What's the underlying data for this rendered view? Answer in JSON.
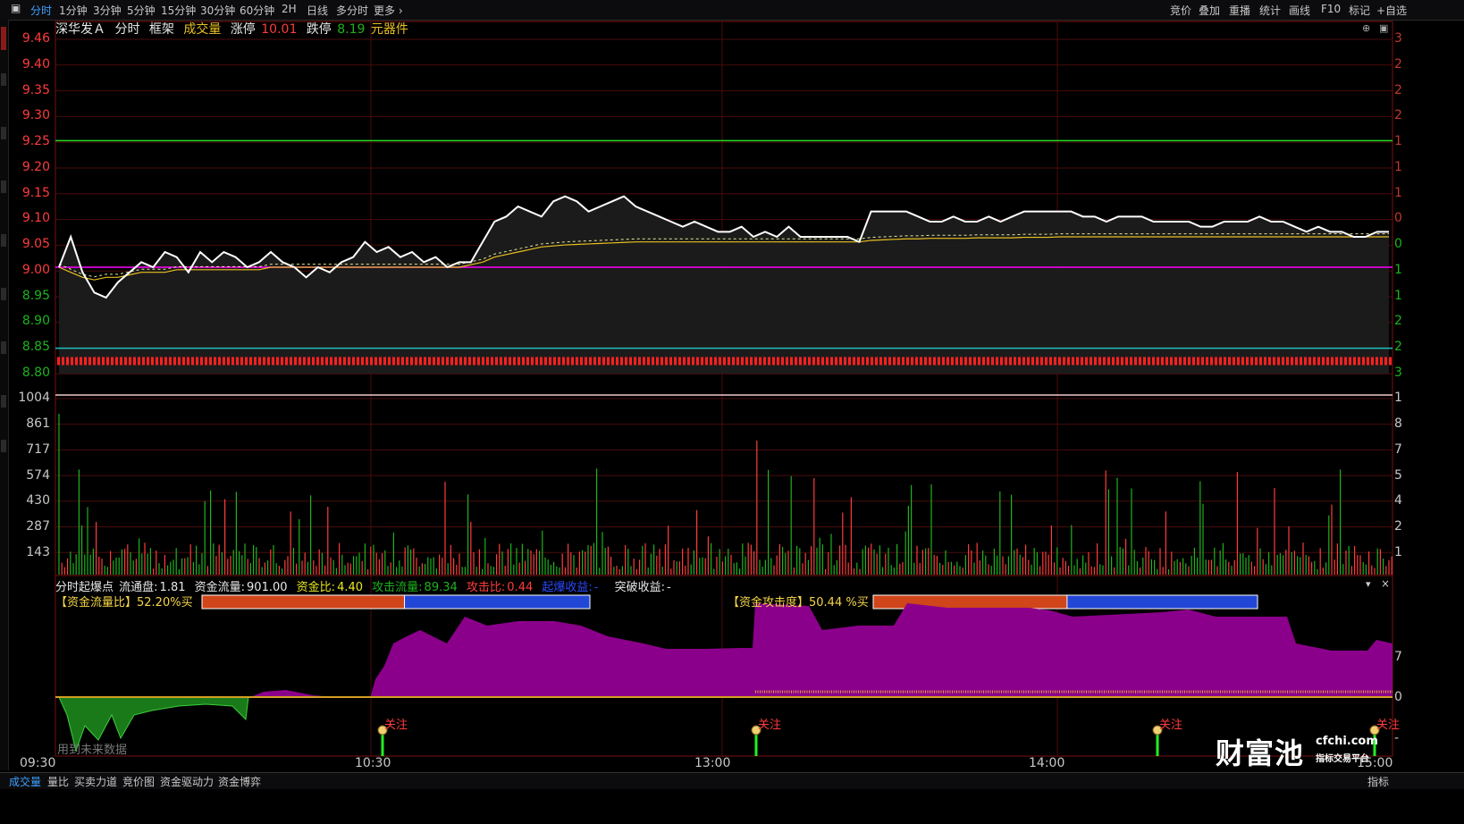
{
  "toolbar": {
    "periods": [
      "分时",
      "1分钟",
      "3分钟",
      "5分钟",
      "15分钟",
      "30分钟",
      "60分钟",
      "2H",
      "日线",
      "多分时",
      "更多 ›"
    ],
    "active_period": "分时",
    "right_tools": [
      "竞价",
      "叠加",
      "重播",
      "统计",
      "画线",
      "F10",
      "标记",
      "+自选"
    ]
  },
  "stock": {
    "name": "深华发Ａ",
    "view": "分时",
    "frame": "框架",
    "volume_label": "成交量",
    "limit_up_label": "涨停",
    "limit_up": "10.01",
    "limit_down_label": "跌停",
    "limit_down": "8.19",
    "sector": "元器件"
  },
  "price_axis": [
    "9.46",
    "9.40",
    "9.35",
    "9.30",
    "9.25",
    "9.20",
    "9.15",
    "9.10",
    "9.05",
    "9.00",
    "8.95",
    "8.90",
    "8.85",
    "8.80"
  ],
  "volume_axis": [
    "1004",
    "861",
    "717",
    "574",
    "430",
    "287",
    "143"
  ],
  "right_axis": [
    "3",
    "2",
    "2",
    "2",
    "1",
    "1",
    "1",
    "0",
    "0",
    "1",
    "1",
    "2",
    "2",
    "3",
    "1",
    "8",
    "7",
    "5",
    "4",
    "2",
    "1",
    "7",
    "0",
    "-"
  ],
  "time_axis": [
    "09:30",
    "10:30",
    "13:00",
    "14:00",
    "15:00"
  ],
  "indicator_header": {
    "title": "分时起爆点",
    "float_label": "流通盘:",
    "float_value": "1.81",
    "flow_label": "资金流量:",
    "flow_value": "901.00",
    "ratio_label": "资金比:",
    "ratio_value": "4.40",
    "attack_flow_label": "攻击流量:",
    "attack_flow_value": "89.34",
    "attack_ratio_label": "攻击比:",
    "attack_ratio_value": "0.44",
    "burst_label": "起爆收益:",
    "burst_value": "-",
    "break_label": "突破收益:",
    "break_value": "-"
  },
  "bar1": {
    "label": "【资金流量比】52.20%买",
    "buy_fraction": 0.522
  },
  "bar2": {
    "label": "【资金攻击度】50.44 %买",
    "buy_fraction": 0.5044
  },
  "signals": [
    "关注",
    "关注",
    "关注",
    "关注"
  ],
  "future_note": "用到未来数据",
  "watermark": {
    "brand": "财富池",
    "domain": "cfchi.com",
    "slogan": "指标交易平台"
  },
  "bottom_tabs": [
    "成交量",
    "量比",
    "买卖力道",
    "竞价图",
    "资金驱动力",
    "资金博弈"
  ],
  "active_bottom_tab": "成交量",
  "bottom_right": "指标",
  "colors": {
    "up": "#ff3b3b",
    "down": "#1db31d",
    "price_line": "#ffffff",
    "avg_line": "#e8c020",
    "ref_line": "#ff00ff",
    "indicator_fill": "#8b008b"
  },
  "chart_data": {
    "type": "line",
    "ylim": [
      8.8,
      9.46
    ],
    "prev_close": 9.01,
    "reference_lines": [
      9.26,
      9.01,
      8.85
    ],
    "price": [
      9.01,
      9.07,
      9.0,
      8.96,
      8.95,
      8.98,
      9.0,
      9.02,
      9.01,
      9.04,
      9.03,
      9.0,
      9.04,
      9.02,
      9.04,
      9.03,
      9.01,
      9.02,
      9.04,
      9.02,
      9.01,
      8.99,
      9.01,
      9.0,
      9.02,
      9.03,
      9.06,
      9.04,
      9.05,
      9.03,
      9.04,
      9.02,
      9.03,
      9.01,
      9.02,
      9.02,
      9.06,
      9.1,
      9.11,
      9.13,
      9.12,
      9.11,
      9.14,
      9.15,
      9.14,
      9.12,
      9.13,
      9.14,
      9.15,
      9.13,
      9.12,
      9.11,
      9.1,
      9.09,
      9.1,
      9.09,
      9.08,
      9.08,
      9.09,
      9.07,
      9.08,
      9.07,
      9.09,
      9.07,
      9.07,
      9.07,
      9.07,
      9.07,
      9.06,
      9.12,
      9.12,
      9.12,
      9.12,
      9.11,
      9.1,
      9.1,
      9.11,
      9.1,
      9.1,
      9.11,
      9.1,
      9.11,
      9.12,
      9.12,
      9.12,
      9.12,
      9.12,
      9.11,
      9.11,
      9.1,
      9.11,
      9.11,
      9.11,
      9.1,
      9.1,
      9.1,
      9.1,
      9.09,
      9.09,
      9.1,
      9.1,
      9.1,
      9.11,
      9.1,
      9.1,
      9.09,
      9.08,
      9.09,
      9.08,
      9.08,
      9.07,
      9.07,
      9.08,
      9.08
    ],
    "avg": [
      9.01,
      9.0,
      8.99,
      8.985,
      8.99,
      8.99,
      8.995,
      9.0,
      9.0,
      9.0,
      9.005,
      9.005,
      9.005,
      9.005,
      9.005,
      9.005,
      9.005,
      9.005,
      9.01,
      9.01,
      9.01,
      9.01,
      9.01,
      9.01,
      9.01,
      9.01,
      9.01,
      9.01,
      9.01,
      9.01,
      9.01,
      9.01,
      9.01,
      9.01,
      9.01,
      9.015,
      9.02,
      9.03,
      9.035,
      9.04,
      9.045,
      9.05,
      9.052,
      9.054,
      9.055,
      9.056,
      9.057,
      9.058,
      9.059,
      9.06,
      9.06,
      9.06,
      9.06,
      9.06,
      9.06,
      9.06,
      9.06,
      9.06,
      9.06,
      9.06,
      9.06,
      9.06,
      9.06,
      9.06,
      9.06,
      9.06,
      9.06,
      9.06,
      9.06,
      9.063,
      9.064,
      9.065,
      9.066,
      9.066,
      9.067,
      9.067,
      9.067,
      9.067,
      9.068,
      9.068,
      9.068,
      9.068,
      9.069,
      9.069,
      9.069,
      9.07,
      9.07,
      9.07,
      9.07,
      9.07,
      9.07,
      9.07,
      9.07,
      9.07,
      9.07,
      9.07,
      9.07,
      9.07,
      9.07,
      9.07,
      9.07,
      9.07,
      9.07,
      9.07,
      9.07,
      9.07,
      9.07,
      9.07,
      9.07,
      9.07,
      9.07,
      9.07,
      9.07,
      9.07
    ]
  }
}
